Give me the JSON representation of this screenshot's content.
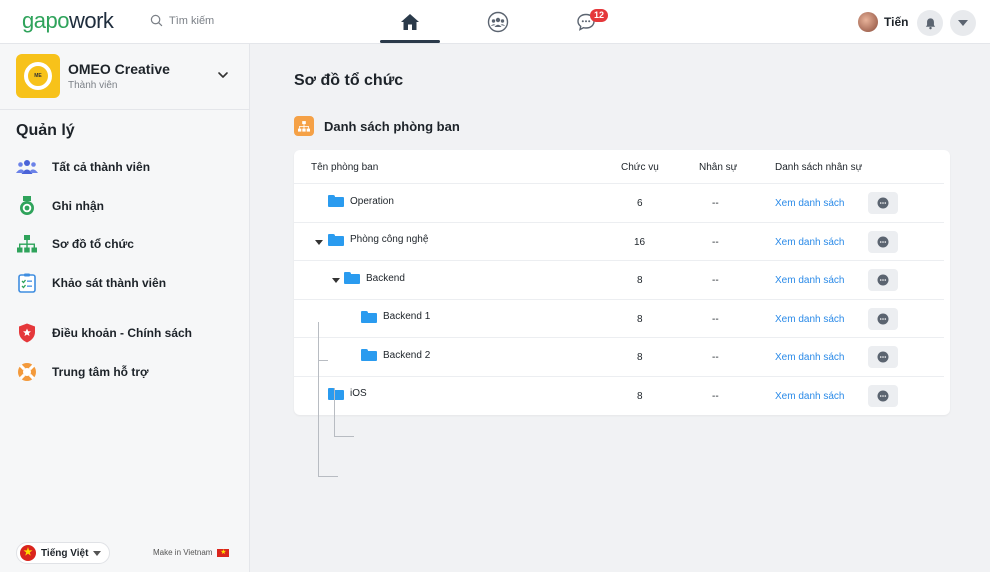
{
  "header": {
    "logo_a": "gapo",
    "logo_b": "work",
    "search_placeholder": "Tìm kiếm",
    "chat_badge": "12",
    "user_name": "Tiến",
    "nav_icons": [
      "home-icon",
      "group-icon",
      "chat-icon"
    ]
  },
  "sidebar": {
    "org_name": "OMEO Creative",
    "org_role": "Thành viên",
    "org_logo_text": "ME",
    "section_title": "Quản lý",
    "items": [
      {
        "label": "Tất cả thành viên",
        "icon": "members-icon"
      },
      {
        "label": "Ghi nhận",
        "icon": "medal-icon"
      },
      {
        "label": "Sơ đồ tổ chức",
        "icon": "org-chart-icon"
      },
      {
        "label": "Khảo sát thành viên",
        "icon": "survey-icon"
      },
      {
        "label": "Điều khoản - Chính sách",
        "icon": "shield-icon"
      },
      {
        "label": "Trung tâm hỗ trợ",
        "icon": "lifebuoy-icon"
      }
    ],
    "language": "Tiếng Việt",
    "made_in": "Make in Vietnam"
  },
  "main": {
    "page_title": "Sơ đồ tổ chức",
    "list_title": "Danh sách phòng ban",
    "columns": {
      "name": "Tên phòng ban",
      "positions": "Chức vụ",
      "staff": "Nhân sự",
      "staff_list": "Danh sách nhân sự"
    },
    "rows": [
      {
        "name": "Operation",
        "positions": "6",
        "staff": "--",
        "link": "Xem danh sách"
      },
      {
        "name": "Phòng công nghệ",
        "positions": "16",
        "staff": "--",
        "link": "Xem danh sách"
      },
      {
        "name": "Backend",
        "positions": "8",
        "staff": "--",
        "link": "Xem danh sách"
      },
      {
        "name": "Backend 1",
        "positions": "8",
        "staff": "--",
        "link": "Xem danh sách"
      },
      {
        "name": "Backend 2",
        "positions": "8",
        "staff": "--",
        "link": "Xem danh sách"
      },
      {
        "name": "iOS",
        "positions": "8",
        "staff": "--",
        "link": "Xem danh sách"
      }
    ]
  },
  "colors": {
    "accent_green": "#2fa35b",
    "link_blue": "#2a8ae8",
    "folder_blue": "#2a9bef",
    "badge_red": "#e5383b",
    "org_yellow": "#f7c21a"
  }
}
